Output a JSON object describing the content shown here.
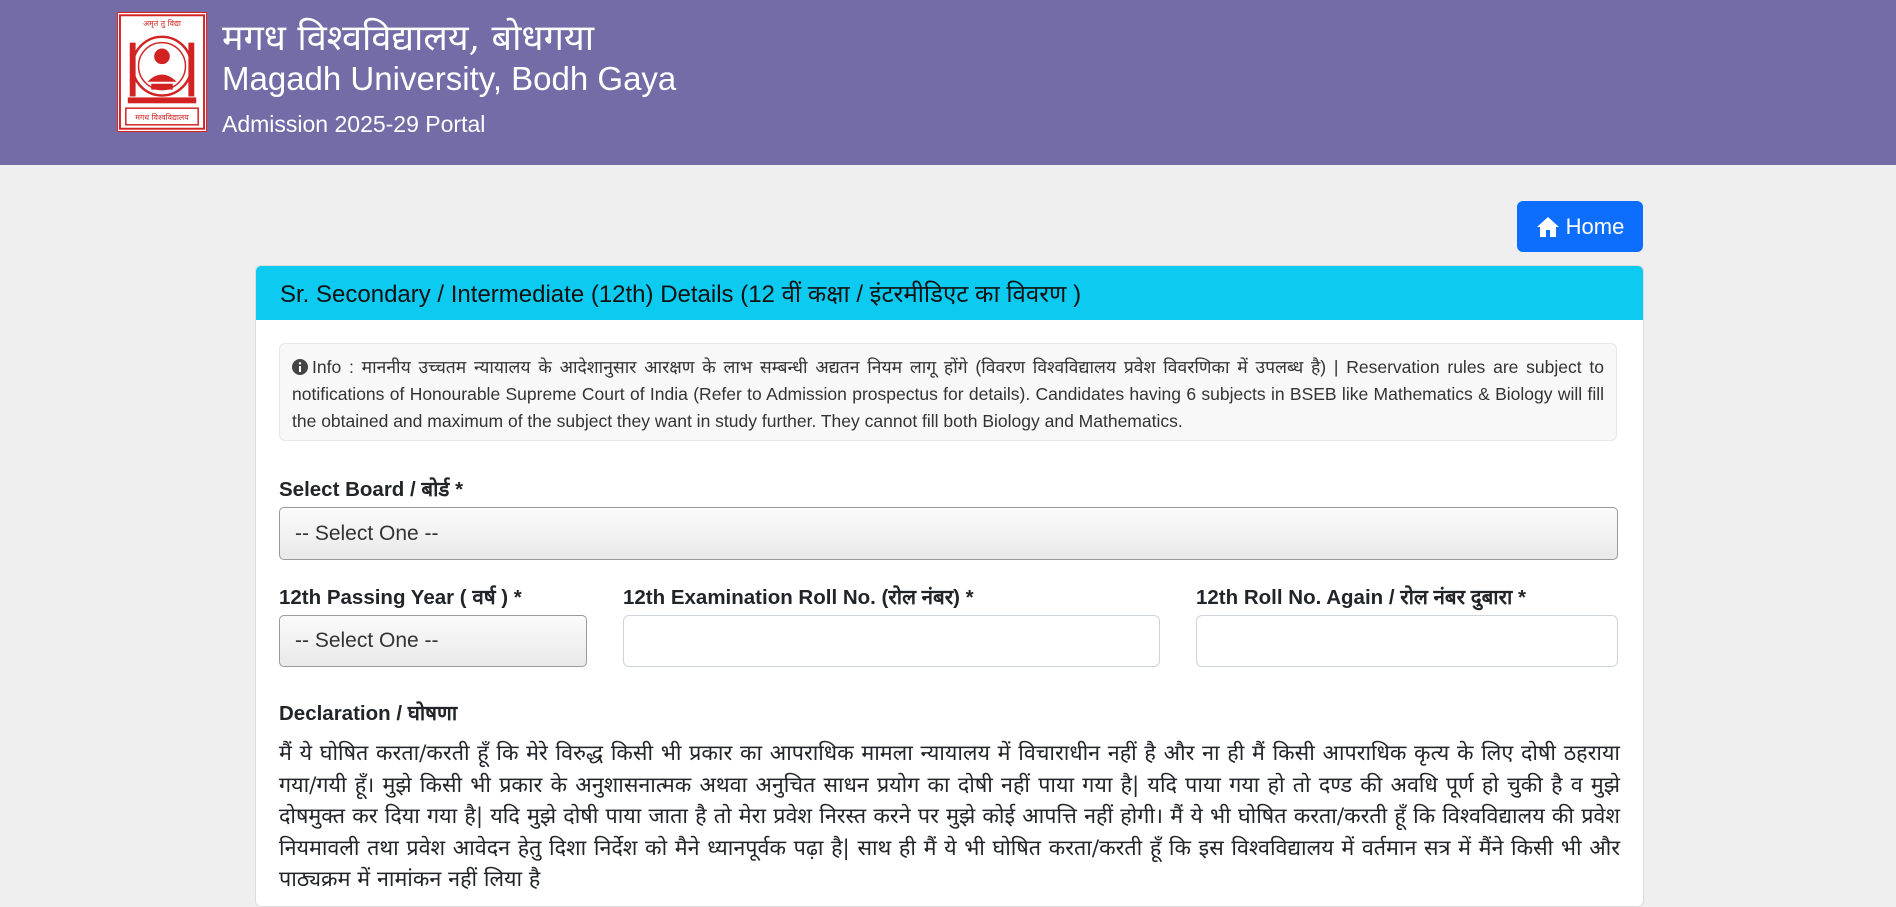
{
  "header": {
    "logo_motto": "अमृतं तु विद्या",
    "logo_caption": "मगध विश्वविद्यालय",
    "title_hindi": "मगध विश्वविद्यालय, बोधगया",
    "title_english": "Magadh University, Bodh Gaya",
    "subtitle": "Admission 2025-29 Portal"
  },
  "toolbar": {
    "home_label": "Home"
  },
  "card": {
    "title": "Sr. Secondary / Intermediate (12th) Details (12 वीं कक्षा / इंटरमीडिएट का विवरण )",
    "info_text": "Info : माननीय उच्चतम न्यायालय के आदेशानुसार आरक्षण के लाभ सम्बन्धी अद्यतन नियम लागू होंगे (विवरण विश्वविद्यालय प्रवेश विवरणिका में उपलब्ध है) | Reservation rules are subject to notifications of Honourable Supreme Court of India (Refer to Admission prospectus for details). Candidates having 6 subjects in BSEB like Mathematics & Biology will fill the obtained and maximum of the subject they want in study further. They cannot fill both Biology and Mathematics.",
    "board_label": "Select Board / बोर्ड *",
    "board_value": "-- Select One --",
    "year_label": "12th Passing Year ( वर्ष ) *",
    "year_value": "-- Select One --",
    "roll_label": "12th Examination Roll No. (रोल नंबर) *",
    "roll_value": "",
    "roll_again_label": "12th Roll No. Again / रोल नंबर दुबारा *",
    "roll_again_value": "",
    "declaration_heading": "Declaration / घोषणा",
    "declaration_text": "मैं ये घोषित करता/करती हूँ कि मेरे विरुद्ध किसी भी प्रकार का आपराधिक मामला न्यायालय में विचाराधीन नहीं है और ना ही मैं किसी आपराधिक कृत्य के लिए दोषी ठहराया गया/गयी हूँ। मुझे किसी भी प्रकार के अनुशासनात्मक अथवा अनुचित साधन प्रयोग का दोषी नहीं पाया गया है| यदि पाया गया हो तो दण्ड की अवधि पूर्ण हो चुकी है व मुझे दोषमुक्त कर दिया गया है| यदि मुझे दोषी पाया जाता है तो मेरा प्रवेश निरस्त करने पर मुझे कोई आपत्ति नहीं होगी। मैं ये भी घोषित करता/करती हूँ कि विश्वविद्यालय की प्रवेश नियमावली तथा प्रवेश आवेदन हेतु दिशा निर्देश को मैने ध्यानपूर्वक पढ़ा है| साथ ही मैं ये भी घोषित करता/करती हूँ कि इस विश्वविद्यालय में वर्तमान सत्र में मैंने किसी भी और पाठ्यक्रम में नामांकन नहीं लिया है"
  },
  "colors": {
    "header_bg": "#736ca7",
    "card_header_bg": "#0dcaf0",
    "home_button_bg": "#0d6efd",
    "logo_red": "#d22222"
  },
  "icons": {
    "home": "home-icon",
    "info": "info-circle-icon",
    "logo": "university-emblem-icon"
  }
}
